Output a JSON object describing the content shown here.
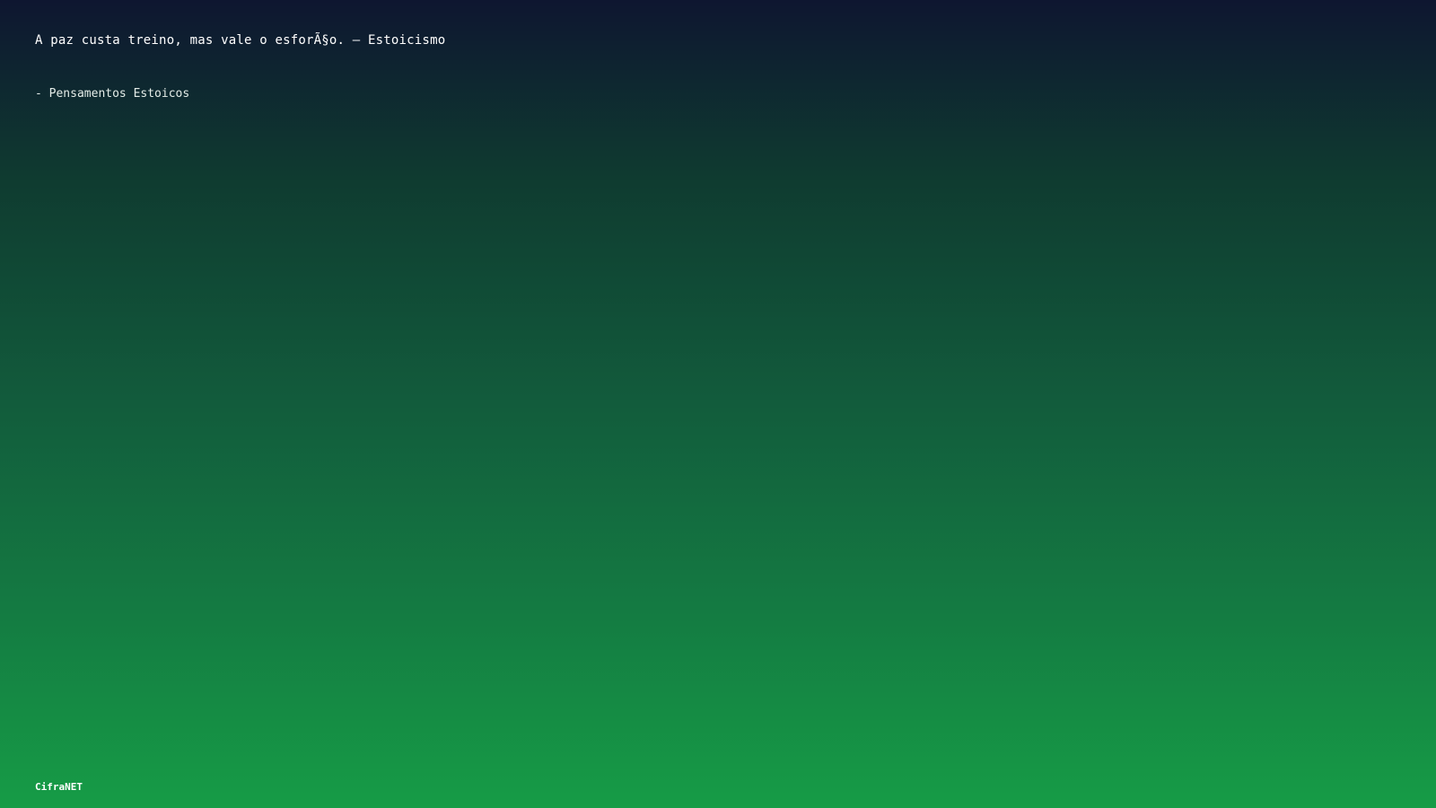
{
  "quote": {
    "text": "A paz custa treino, mas vale o esforÃ§o. — Estoicismo"
  },
  "attribution": {
    "text": "- Pensamentos Estoicos"
  },
  "footer": {
    "brand": "CifraNET"
  }
}
